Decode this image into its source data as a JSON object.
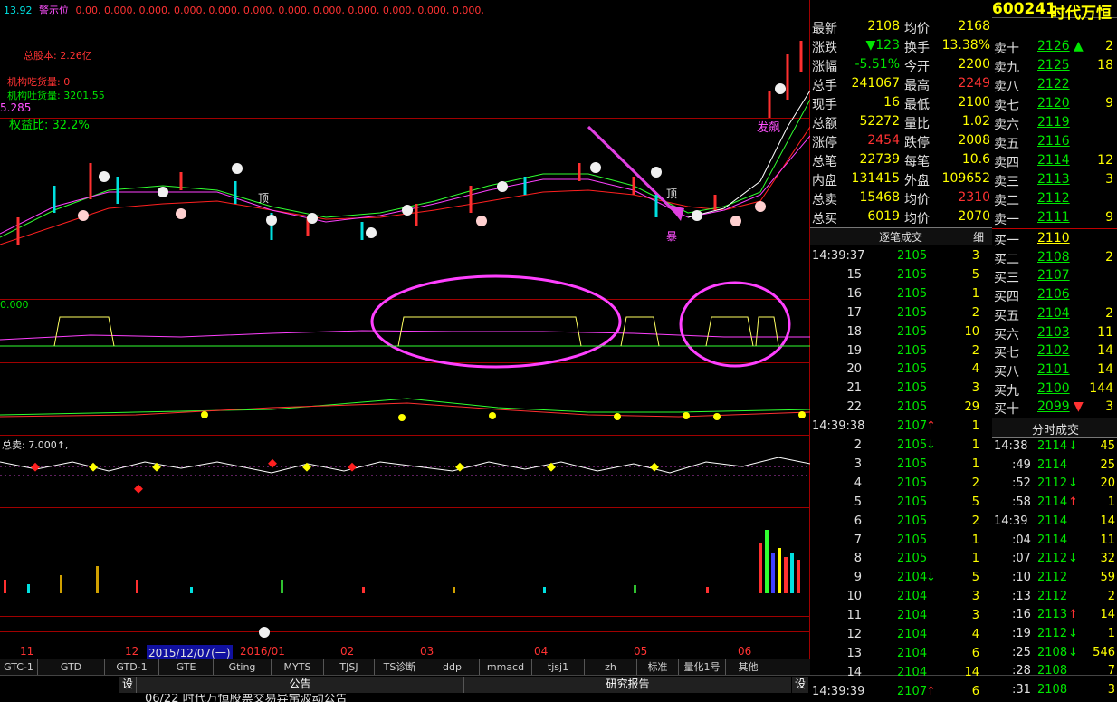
{
  "topbar": {
    "left_value": "13.92",
    "warn_label": "警示位",
    "values": "0.00, 0.000, 0.000, 0.000, 0.000, 0.000, 0.000, 0.000, 0.000, 0.000, 0.000, 0.000,"
  },
  "stock": {
    "code": "600241",
    "name": "时代万恒"
  },
  "overlays": {
    "total_capital": "总股本: 2.26亿",
    "inst_buy": "机构吃货量: 0",
    "inst_sell": "机构吐货量: 3201.55",
    "value_285": "5.285",
    "equity_ratio": "权益比: 32.2%",
    "ind1_value": "0.000",
    "ind3_label": "总卖: 7.000↑,",
    "label_top": "顶",
    "label_fei": "发飙",
    "label_bao": "暴"
  },
  "tabs": [
    "GTC-1",
    "GTD",
    "GTD-1",
    "GTE",
    "Gting",
    "MYTS",
    "TJSJ",
    "TS诊断",
    "ddp",
    "mmacd",
    "tjsj1",
    "zh",
    "标准",
    "量化1号",
    "其他"
  ],
  "time_axis": [
    "11",
    "12",
    "2015/12/07(一)",
    "2016/01",
    "02",
    "03",
    "04",
    "05",
    "06"
  ],
  "bottom": {
    "settings_left": "设",
    "announcement": "公告",
    "research": "研究报告",
    "settings_right": "设",
    "news": "06/22 时代万恒股票交易异常波动公告"
  },
  "quote": [
    {
      "l1": "最新",
      "v1": "2108",
      "l2": "均价",
      "v2": "2168"
    },
    {
      "l1": "涨跌",
      "v1": "▼123",
      "l2": "换手",
      "v2": "13.38%"
    },
    {
      "l1": "涨幅",
      "v1": "-5.51%",
      "l2": "今开",
      "v2": "2200"
    },
    {
      "l1": "总手",
      "v1": "241067",
      "l2": "最高",
      "v2": "2249"
    },
    {
      "l1": "现手",
      "v1": "16",
      "l2": "最低",
      "v2": "2100"
    },
    {
      "l1": "总额",
      "v1": "52272",
      "l2": "量比",
      "v2": "1.02"
    },
    {
      "l1": "涨停",
      "v1": "2454",
      "l2": "跌停",
      "v2": "2008"
    },
    {
      "l1": "总笔",
      "v1": "22739",
      "l2": "每笔",
      "v2": "10.6"
    },
    {
      "l1": "内盘",
      "v1": "131415",
      "l2": "外盘",
      "v2": "109652"
    },
    {
      "l1": "总卖",
      "v1": "15468",
      "l2": "均价",
      "v2": "2310"
    },
    {
      "l1": "总买",
      "v1": "6019",
      "l2": "均价",
      "v2": "2070"
    }
  ],
  "trades_title": "逐笔成交",
  "trades_detail": "细",
  "trades": [
    {
      "t": "14:39:37",
      "p": "2105",
      "v": "3",
      "a": ""
    },
    {
      "t": "15",
      "p": "2105",
      "v": "5",
      "a": ""
    },
    {
      "t": "16",
      "p": "2105",
      "v": "1",
      "a": ""
    },
    {
      "t": "17",
      "p": "2105",
      "v": "2",
      "a": ""
    },
    {
      "t": "18",
      "p": "2105",
      "v": "10",
      "a": ""
    },
    {
      "t": "19",
      "p": "2105",
      "v": "2",
      "a": ""
    },
    {
      "t": "20",
      "p": "2105",
      "v": "4",
      "a": ""
    },
    {
      "t": "21",
      "p": "2105",
      "v": "3",
      "a": ""
    },
    {
      "t": "22",
      "p": "2105",
      "v": "29",
      "a": ""
    },
    {
      "t": "14:39:38",
      "p": "2107",
      "v": "1",
      "a": "↑"
    },
    {
      "t": "2",
      "p": "2105",
      "v": "1",
      "a": "↓"
    },
    {
      "t": "3",
      "p": "2105",
      "v": "1",
      "a": ""
    },
    {
      "t": "4",
      "p": "2105",
      "v": "2",
      "a": ""
    },
    {
      "t": "5",
      "p": "2105",
      "v": "5",
      "a": ""
    },
    {
      "t": "6",
      "p": "2105",
      "v": "2",
      "a": ""
    },
    {
      "t": "7",
      "p": "2105",
      "v": "1",
      "a": ""
    },
    {
      "t": "8",
      "p": "2105",
      "v": "1",
      "a": ""
    },
    {
      "t": "9",
      "p": "2104",
      "v": "5",
      "a": "↓"
    },
    {
      "t": "10",
      "p": "2104",
      "v": "3",
      "a": ""
    },
    {
      "t": "11",
      "p": "2104",
      "v": "3",
      "a": ""
    },
    {
      "t": "12",
      "p": "2104",
      "v": "4",
      "a": ""
    },
    {
      "t": "13",
      "p": "2104",
      "v": "6",
      "a": ""
    },
    {
      "t": "14",
      "p": "2104",
      "v": "14",
      "a": ""
    },
    {
      "t": "14:39:39",
      "p": "2107",
      "v": "6",
      "a": "↑"
    }
  ],
  "sell_orders": [
    {
      "l": "卖十",
      "p": "2126",
      "v": "2",
      "a": "▲"
    },
    {
      "l": "卖九",
      "p": "2125",
      "v": "18",
      "a": ""
    },
    {
      "l": "卖八",
      "p": "2122",
      "v": "",
      "a": ""
    },
    {
      "l": "卖七",
      "p": "2120",
      "v": "9",
      "a": ""
    },
    {
      "l": "卖六",
      "p": "2119",
      "v": "",
      "a": ""
    },
    {
      "l": "卖五",
      "p": "2116",
      "v": "",
      "a": ""
    },
    {
      "l": "卖四",
      "p": "2114",
      "v": "12",
      "a": ""
    },
    {
      "l": "卖三",
      "p": "2113",
      "v": "3",
      "a": ""
    },
    {
      "l": "卖二",
      "p": "2112",
      "v": "",
      "a": ""
    },
    {
      "l": "卖一",
      "p": "2111",
      "v": "9",
      "a": ""
    }
  ],
  "buy_orders": [
    {
      "l": "买一",
      "p": "2110",
      "v": "",
      "a": ""
    },
    {
      "l": "买二",
      "p": "2108",
      "v": "2",
      "a": ""
    },
    {
      "l": "买三",
      "p": "2107",
      "v": "",
      "a": ""
    },
    {
      "l": "买四",
      "p": "2106",
      "v": "",
      "a": ""
    },
    {
      "l": "买五",
      "p": "2104",
      "v": "2",
      "a": ""
    },
    {
      "l": "买六",
      "p": "2103",
      "v": "11",
      "a": ""
    },
    {
      "l": "买七",
      "p": "2102",
      "v": "14",
      "a": ""
    },
    {
      "l": "买八",
      "p": "2101",
      "v": "14",
      "a": ""
    },
    {
      "l": "买九",
      "p": "2100",
      "v": "144",
      "a": ""
    },
    {
      "l": "买十",
      "p": "2099",
      "v": "3",
      "a": "▼"
    }
  ],
  "tick_title": "分时成交",
  "ticks": [
    {
      "t": "14:38",
      "p": "2114",
      "a": "↓",
      "v": "45"
    },
    {
      "t": ":49",
      "p": "2114",
      "a": "",
      "v": "25"
    },
    {
      "t": ":52",
      "p": "2112",
      "a": "↓",
      "v": "20"
    },
    {
      "t": ":58",
      "p": "2114",
      "a": "↑",
      "v": "1"
    },
    {
      "t": "14:39",
      "p": "2114",
      "a": "",
      "v": "14"
    },
    {
      "t": ":04",
      "p": "2114",
      "a": "",
      "v": "11"
    },
    {
      "t": ":07",
      "p": "2112",
      "a": "↓",
      "v": "32"
    },
    {
      "t": ":10",
      "p": "2112",
      "a": "",
      "v": "59"
    },
    {
      "t": ":13",
      "p": "2112",
      "a": "",
      "v": "2"
    },
    {
      "t": ":16",
      "p": "2113",
      "a": "↑",
      "v": "14"
    },
    {
      "t": ":19",
      "p": "2112",
      "a": "↓",
      "v": "1"
    },
    {
      "t": ":25",
      "p": "2108",
      "a": "↓",
      "v": "546"
    },
    {
      "t": ":28",
      "p": "2108",
      "a": "",
      "v": "7"
    },
    {
      "t": ":31",
      "p": "2108",
      "a": "",
      "v": "3"
    }
  ]
}
